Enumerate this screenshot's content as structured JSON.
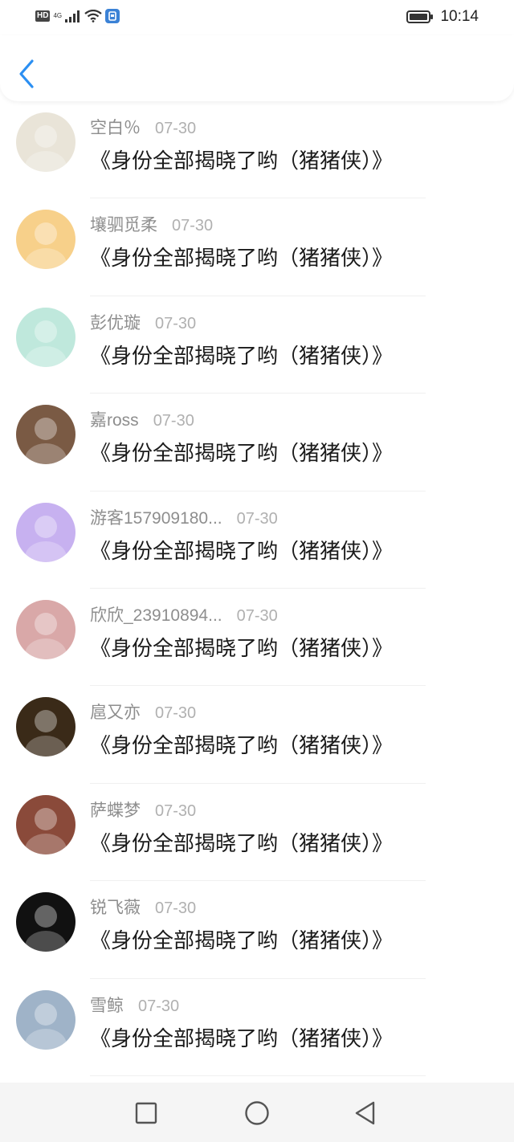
{
  "status_bar": {
    "hd": "HD",
    "network": "4G",
    "time": "10:14",
    "icons": [
      "hd-icon",
      "signal-icon",
      "wifi-icon",
      "notification-app-icon",
      "battery-icon"
    ]
  },
  "header": {
    "back_icon": "chevron-left-icon"
  },
  "items": [
    {
      "name": "空白％",
      "date": "07-30",
      "title": "《身份全部揭晓了哟（猪猪侠）》",
      "avatar_color": "#e9e4d8"
    },
    {
      "name": "壤驷觅柔",
      "date": "07-30",
      "title": "《身份全部揭晓了哟（猪猪侠）》",
      "avatar_color": "#f7d08a"
    },
    {
      "name": "彭优璇",
      "date": "07-30",
      "title": "《身份全部揭晓了哟（猪猪侠）》",
      "avatar_color": "#bfe8dc"
    },
    {
      "name": "嘉ross",
      "date": "07-30",
      "title": "《身份全部揭晓了哟（猪猪侠）》",
      "avatar_color": "#7a5a44"
    },
    {
      "name": "游客157909180...",
      "date": "07-30",
      "title": "《身份全部揭晓了哟（猪猪侠）》",
      "avatar_color": "#c7b1f0"
    },
    {
      "name": "欣欣_23910894...",
      "date": "07-30",
      "title": "《身份全部揭晓了哟（猪猪侠）》",
      "avatar_color": "#d9a8a8"
    },
    {
      "name": "扈又亦",
      "date": "07-30",
      "title": "《身份全部揭晓了哟（猪猪侠）》",
      "avatar_color": "#3a2a18"
    },
    {
      "name": "萨蝶梦",
      "date": "07-30",
      "title": "《身份全部揭晓了哟（猪猪侠）》",
      "avatar_color": "#8a4a3a"
    },
    {
      "name": "锐飞薇",
      "date": "07-30",
      "title": "《身份全部揭晓了哟（猪猪侠）》",
      "avatar_color": "#111111"
    },
    {
      "name": "雪鲸",
      "date": "07-30",
      "title": "《身份全部揭晓了哟（猪猪侠）》",
      "avatar_color": "#9fb3c8"
    }
  ],
  "nav_bar": {
    "icons": [
      "recent-apps-icon",
      "home-icon",
      "back-triangle-icon"
    ]
  }
}
